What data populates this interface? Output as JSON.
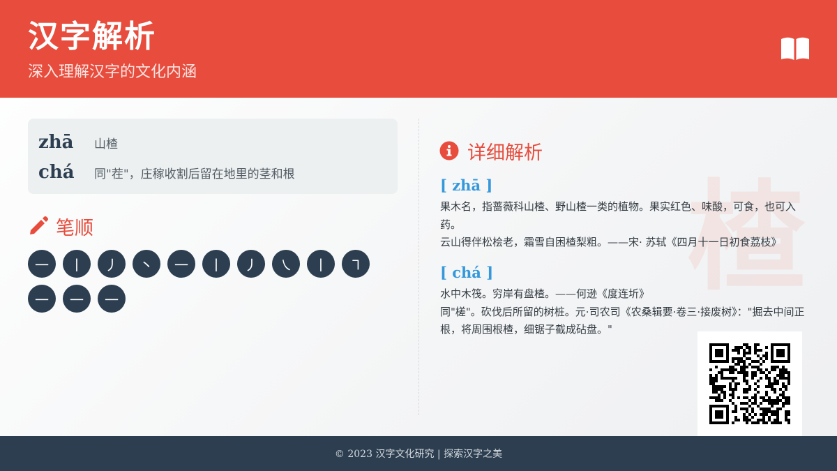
{
  "header": {
    "title": "汉字解析",
    "subtitle": "深入理解汉字的文化内涵",
    "icon": "book-open-icon"
  },
  "pronunciations": [
    {
      "pinyin": "zhā",
      "meaning": "山楂"
    },
    {
      "pinyin": "chá",
      "meaning": "同\"茬\"，庄稼收割后留在地里的茎和根"
    }
  ],
  "stroke_section": {
    "title": "笔顺",
    "icon": "pencil-icon",
    "strokes": [
      "一",
      "丨",
      "丿",
      "丶",
      "一",
      "丨",
      "丿",
      "㇏",
      "丨",
      "㇕",
      "一",
      "一",
      "一"
    ]
  },
  "detail_section": {
    "title": "详细解析",
    "icon": "info-circle-icon",
    "watermark_char": "楂",
    "entries": [
      {
        "pinyin": "[ zhā ]",
        "lines": [
          "果木名，指蔷薇科山楂、野山楂一类的植物。果实红色、味酸，可食，也可入药。",
          "云山得伴松桧老，霜雪自困楂梨粗。——宋· 苏轼《四月十一日初食荔枝》"
        ]
      },
      {
        "pinyin": "[ chá ]",
        "lines": [
          "水中木筏。穷岸有盘楂。——何逊《度连圻》",
          "同\"槎\"。砍伐后所留的树桩。元·司农司《农桑辑要·卷三·接废树》：\"掘去中间正根，将周围根楂，细锯子截成砧盘。\""
        ]
      }
    ]
  },
  "qr_code": {
    "icon": "qr-code-icon"
  },
  "footer": {
    "text": "© 2023 汉字文化研究 | 探索汉字之美"
  },
  "colors": {
    "accent": "#e74c3c",
    "dark": "#2c3e50",
    "link": "#3498db",
    "panel": "#ecf0f1"
  }
}
